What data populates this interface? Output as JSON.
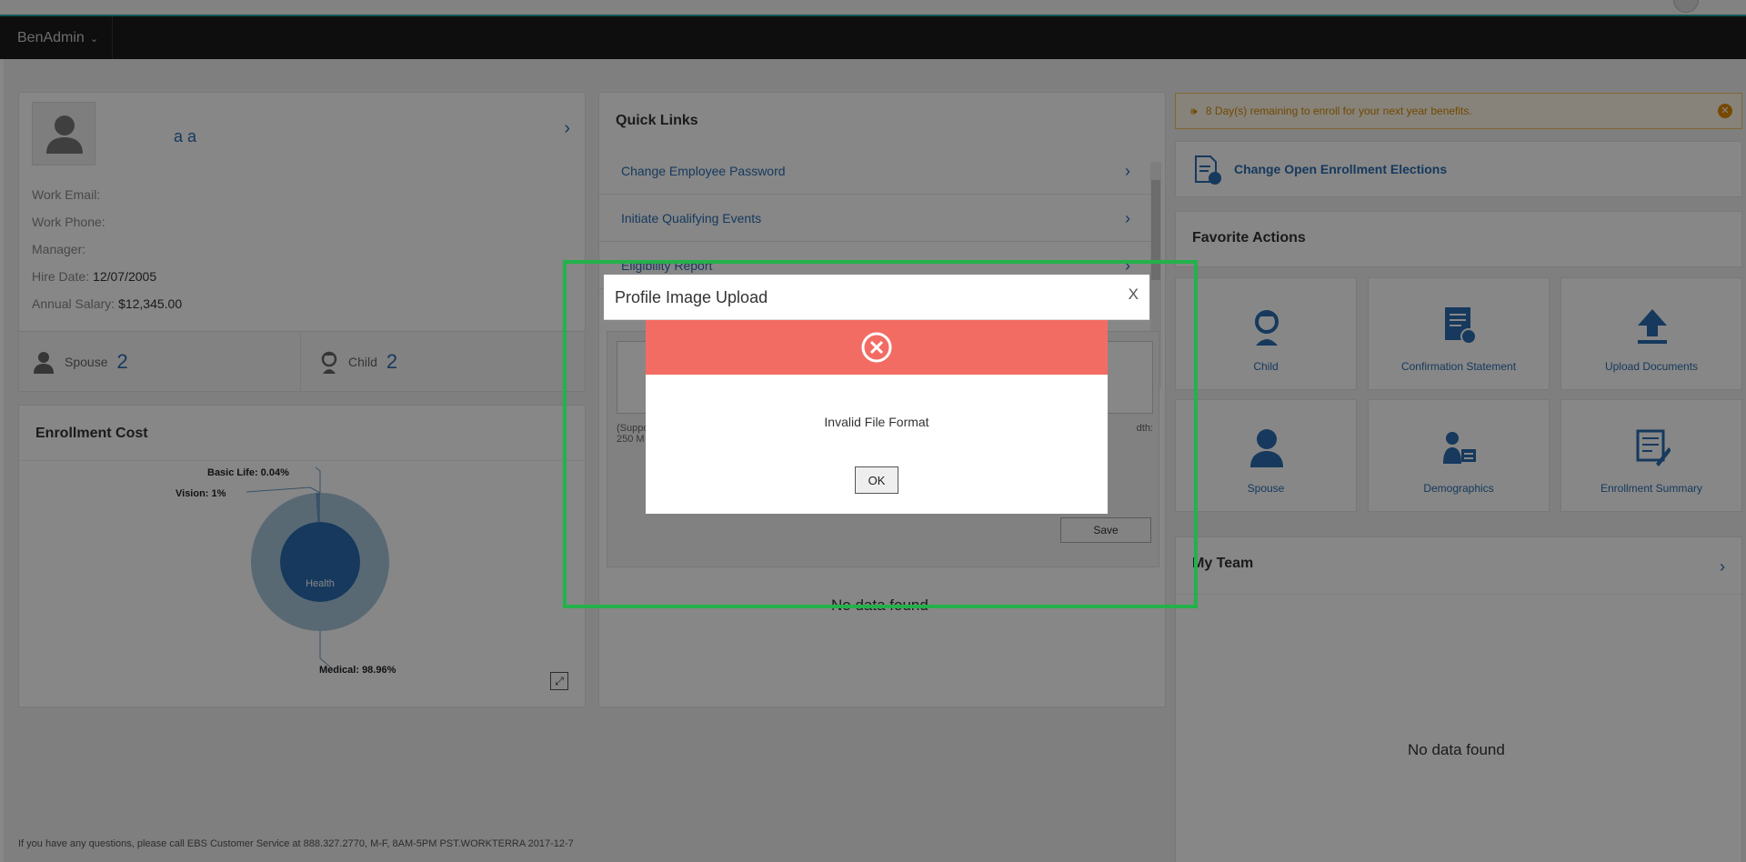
{
  "nav": {
    "brand": "BenAdmin"
  },
  "profile": {
    "name": "a a",
    "fields": [
      {
        "label": "Work Email:",
        "value": ""
      },
      {
        "label": "Work Phone:",
        "value": ""
      },
      {
        "label": "Manager:",
        "value": ""
      },
      {
        "label": "Hire Date:",
        "value": "12/07/2005"
      },
      {
        "label": "Annual Salary:",
        "value": "$12,345.00"
      }
    ],
    "dependents": [
      {
        "label": "Spouse",
        "count": "2"
      },
      {
        "label": "Child",
        "count": "2"
      }
    ]
  },
  "enrollment_cost": {
    "title": "Enrollment Cost",
    "center_label": "Health",
    "slice_labels": [
      "Basic Life: 0.04%",
      "Vision: 1%",
      "Medical: 98.96%"
    ]
  },
  "chart_data": {
    "type": "pie",
    "title": "Enrollment Cost",
    "categories": [
      "Medical",
      "Vision",
      "Basic Life"
    ],
    "values": [
      98.96,
      1,
      0.04
    ],
    "inner_label": "Health"
  },
  "quick_links": {
    "title": "Quick Links",
    "items": [
      "Change Employee Password",
      "Initiate Qualifying Events",
      "Eligibility Report"
    ],
    "upload_note_left": "(Suppo",
    "upload_note_left2": "250 M",
    "upload_note_right": "dth:",
    "save_label": "Save",
    "no_data": "No data found"
  },
  "alert": {
    "text": "8 Day(s) remaining to enroll for your next year benefits."
  },
  "change_oe": {
    "label": "Change Open Enrollment Elections"
  },
  "favorites": {
    "title": "Favorite Actions",
    "items": [
      "Child",
      "Confirmation Statement",
      "Upload Documents",
      "Spouse",
      "Demographics",
      "Enrollment Summary"
    ]
  },
  "my_team": {
    "title": "My Team",
    "no_data": "No data found"
  },
  "footer": {
    "text": "If you have any questions, please call EBS Customer Service at 888.327.2770, M-F, 8AM-5PM PST.WORKTERRA 2017-12-7"
  },
  "modal": {
    "title": "Profile Image Upload",
    "close": "X",
    "message": "Invalid File Format",
    "ok_label": "OK"
  },
  "colors": {
    "accent": "#2a6db0",
    "error": "#f26c64",
    "highlight": "#22b24a",
    "navbar": "#1b1b1b"
  }
}
